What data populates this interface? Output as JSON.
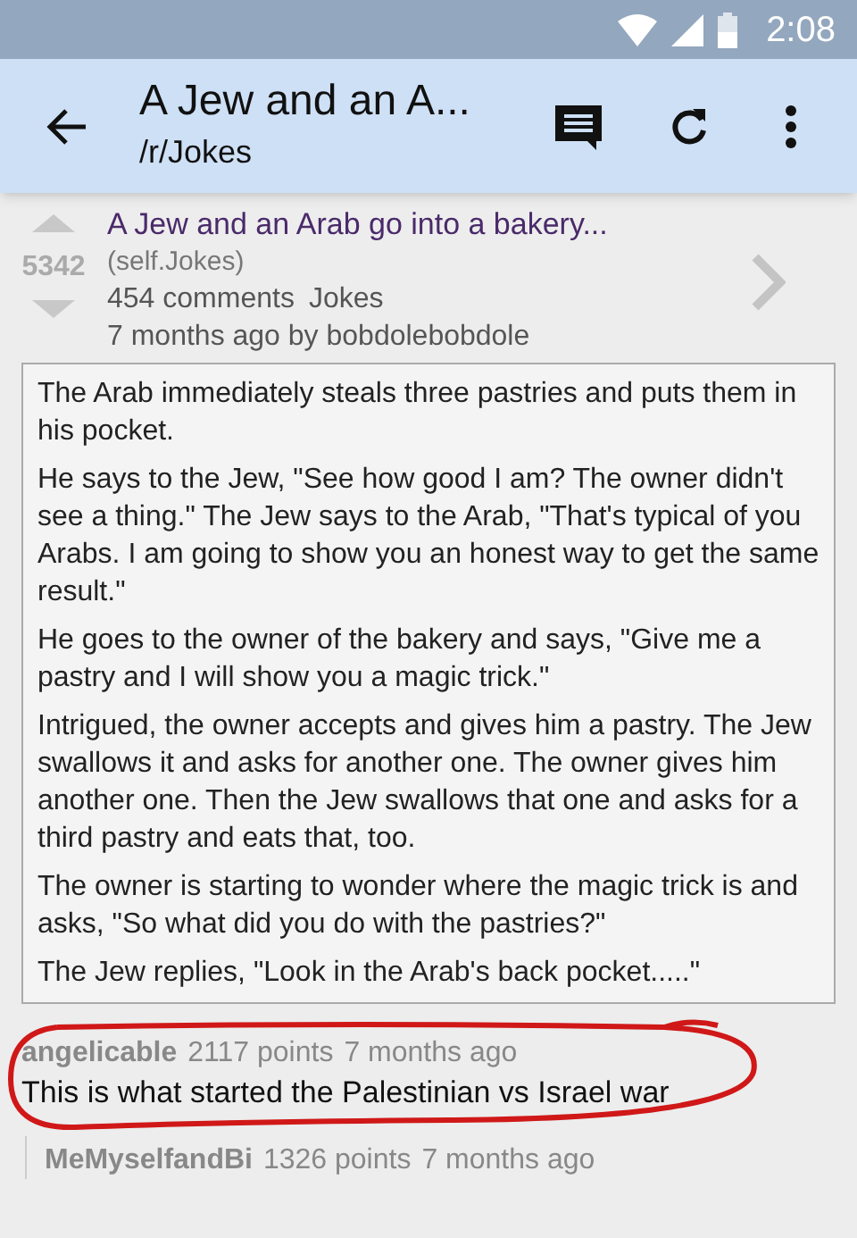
{
  "status_bar": {
    "time": "2:08"
  },
  "toolbar": {
    "title": "A Jew and an A...",
    "subtitle": "/r/Jokes"
  },
  "post": {
    "score": "5342",
    "title": "A Jew and an Arab go into a bakery...",
    "domain": "(self.Jokes)",
    "comments": "454 comments",
    "subreddit": "Jokes",
    "meta": "7 months ago by bobdolebobdole",
    "paragraphs": [
      "The Arab immediately steals three pastries and puts them in his pocket.",
      "He says to the Jew, \"See how good I am? The owner didn't see a thing.\" The Jew says to the Arab, \"That's typical of you Arabs. I am going to show you an honest way to get the same result.\"",
      "He goes to the owner of the bakery and says, \"Give me a pastry and I will show you a magic trick.\"",
      "Intrigued, the owner accepts and gives him a pastry. The Jew swallows it and asks for another one. The owner gives him another one. Then the Jew swallows that one and asks for a third pastry and eats that, too.",
      "The owner is starting to wonder where the magic trick is and asks, \"So what did you do with the pastries?\"",
      "The Jew replies, \"Look in the Arab's back pocket.....\""
    ]
  },
  "comments": [
    {
      "author": "angelicable",
      "points": "2117 points",
      "age": "7 months ago",
      "body": "This is what started the Palestinian vs Israel war",
      "circled": true
    },
    {
      "author": "MeMyselfandBi",
      "points": "1326 points",
      "age": "7 months ago"
    }
  ]
}
